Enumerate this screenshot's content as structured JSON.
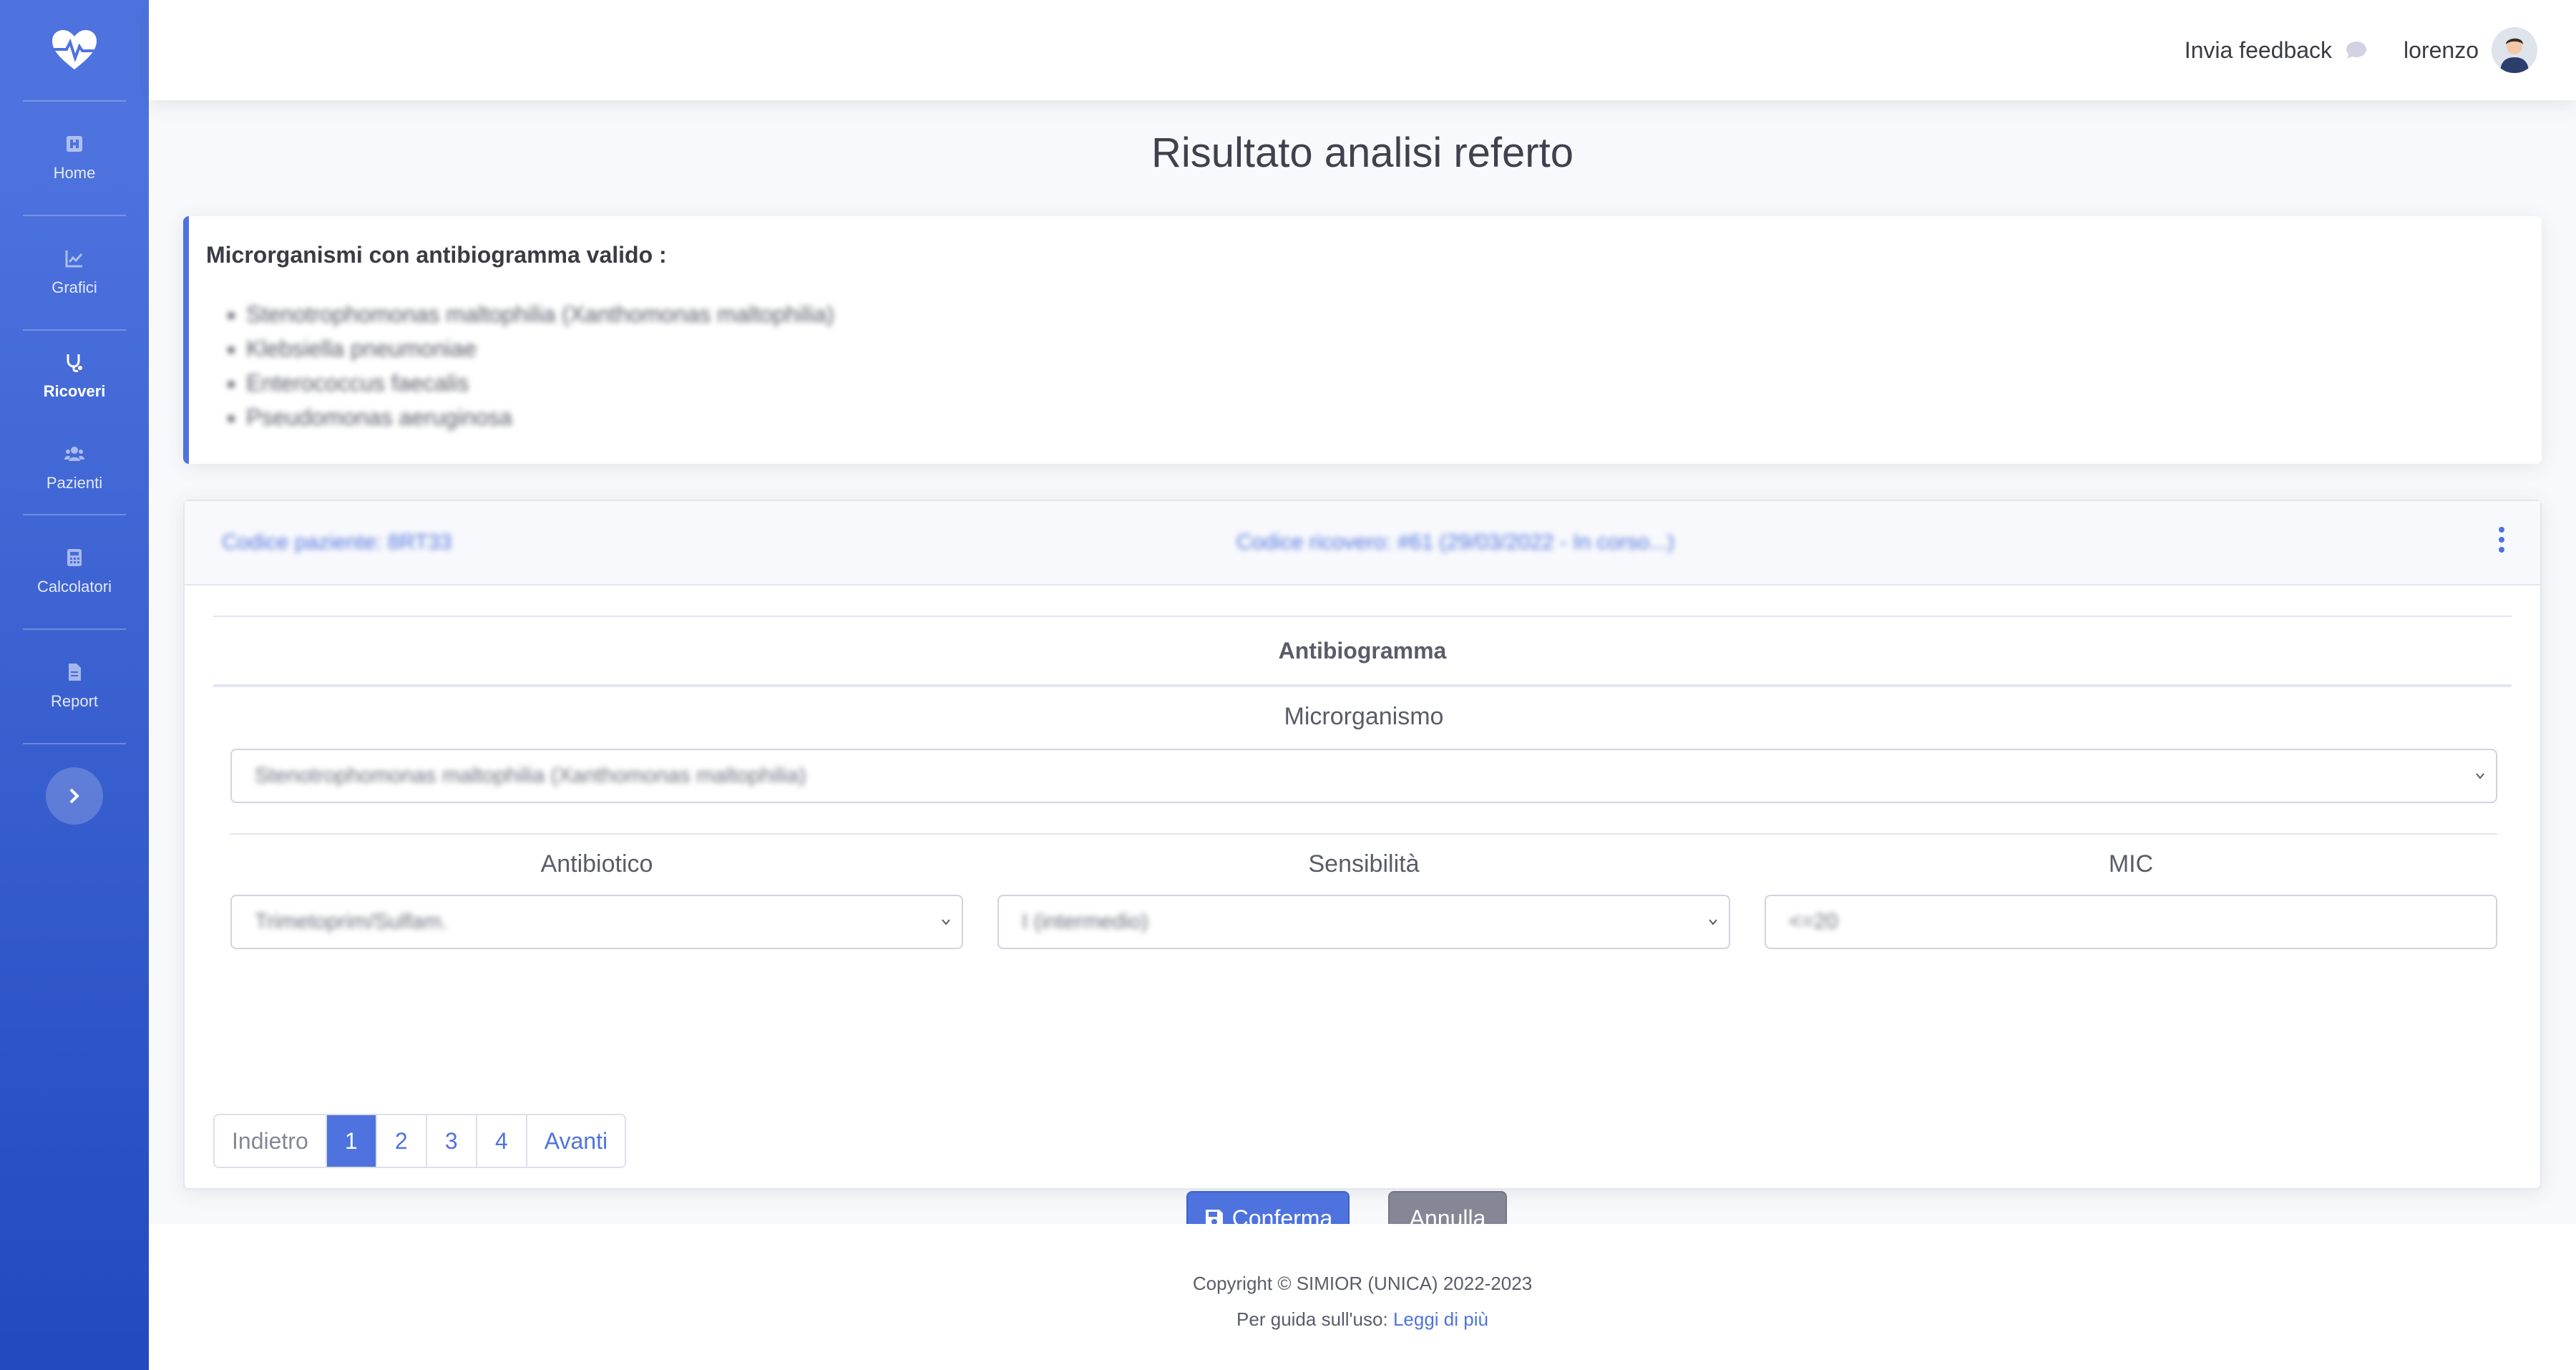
{
  "sidebar": {
    "items": [
      {
        "label": "Home",
        "icon": "home-icon"
      },
      {
        "label": "Grafici",
        "icon": "chart-icon"
      },
      {
        "label": "Ricoveri",
        "icon": "stethoscope-icon"
      },
      {
        "label": "Pazienti",
        "icon": "users-icon"
      },
      {
        "label": "Calcolatori",
        "icon": "calculator-icon"
      },
      {
        "label": "Report",
        "icon": "file-icon"
      }
    ],
    "active": "Ricoveri"
  },
  "topbar": {
    "feedback_label": "Invia feedback",
    "username": "lorenzo"
  },
  "page": {
    "title": "Risultato analisi referto"
  },
  "alert": {
    "title": "Microrganismi con antibiogramma valido :",
    "items": [
      "Stenotrophomonas maltophilia (Xanthomonas maltophilia)",
      "Klebsiella pneumoniae",
      "Enterococcus faecalis",
      "Pseudomonas aeruginosa"
    ]
  },
  "card": {
    "patient_code": "Codice paziente: 8RT33",
    "admission_code": "Codice ricovero: #61 (29/03/2022 - In corso...)",
    "section_title": "Antibiogramma",
    "microorganism_label": "Microrganismo",
    "microorganism_value": "Stenotrophomonas maltophilia (Xanthomonas maltophilia)",
    "antibiotic_label": "Antibiotico",
    "antibiotic_value": "Trimetoprim/Sulfam.",
    "sensitivity_label": "Sensibilità",
    "sensitivity_value": "I (intermedio)",
    "mic_label": "MIC",
    "mic_value": "<=20"
  },
  "pagination": {
    "prev": "Indietro",
    "pages": [
      "1",
      "2",
      "3",
      "4"
    ],
    "current": "1",
    "next": "Avanti"
  },
  "actions": {
    "confirm": "Conferma",
    "cancel": "Annulla"
  },
  "footer": {
    "copyright": "Copyright © SIMIOR (UNICA) 2022-2023",
    "guide_prefix": "Per guida sull'uso:",
    "guide_link": "Leggi di più"
  },
  "colors": {
    "primary": "#4e73df",
    "secondary": "#858796",
    "sidebar_gradient_end": "#224abe"
  }
}
